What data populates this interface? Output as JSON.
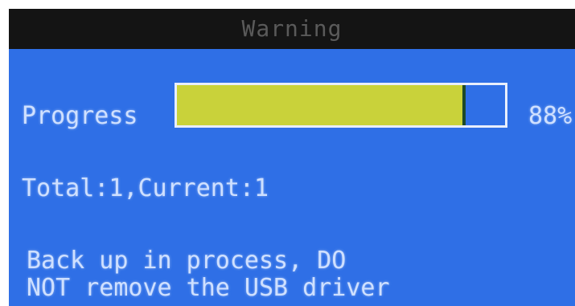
{
  "dialog": {
    "title": "Warning",
    "progress_label": "Progress",
    "progress_fraction": 0.88,
    "progress_text": "88%",
    "counts_text": "Total:1,Current:1",
    "message_lines": [
      "Back up in process, DO",
      "NOT remove the USB driver"
    ]
  },
  "colors": {
    "screen_background": "#2f6fe6",
    "title_bar": "#141414",
    "title_text": "#5a5a5a",
    "progress_fill": "#c9d23a",
    "progress_border": "#e8eefc",
    "text": "#cfe0ff"
  }
}
